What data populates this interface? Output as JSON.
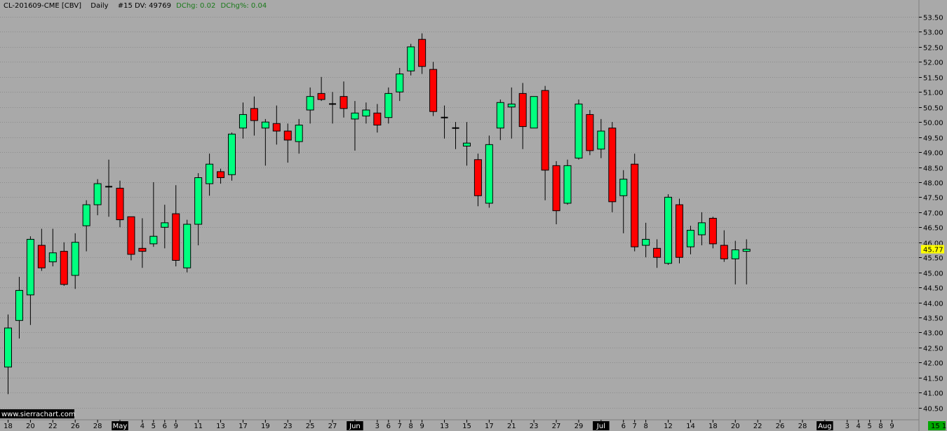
{
  "header": {
    "symbol": "CL-201609-CME [CBV]",
    "period": "Daily",
    "study": "#15 DV: 49769",
    "dchg": "DChg: 0.02",
    "dchg_pct": "DChg%: 0.04"
  },
  "watermark": "www.sierrachart.com",
  "last_price_label": "45.77",
  "corner_label": "15 1",
  "colors": {
    "background": "#a9a9a9",
    "up": "#00ff7f",
    "down": "#ff0000",
    "wick": "#000000",
    "gridline": "#8c8c8c",
    "last_price_bg": "#ffff00",
    "corner_bg": "#00a800",
    "header_green": "#1a7a1a"
  },
  "chart_data": {
    "type": "candlestick",
    "ylim": [
      40.3,
      53.8
    ],
    "grid": true,
    "y_ticks": [
      "40.50",
      "41.00",
      "41.50",
      "42.00",
      "42.50",
      "43.00",
      "43.50",
      "44.00",
      "44.50",
      "45.00",
      "45.50",
      "46.00",
      "46.50",
      "47.00",
      "47.50",
      "48.00",
      "48.50",
      "49.00",
      "49.50",
      "50.00",
      "50.50",
      "51.00",
      "51.50",
      "52.00",
      "52.50",
      "53.00",
      "53.50"
    ],
    "x_ticks": [
      {
        "label": "18",
        "i": 0
      },
      {
        "label": "20",
        "i": 2
      },
      {
        "label": "22",
        "i": 4
      },
      {
        "label": "26",
        "i": 6
      },
      {
        "label": "28",
        "i": 8
      },
      {
        "label": "May",
        "i": 10,
        "month": true
      },
      {
        "label": "4",
        "i": 12
      },
      {
        "label": "5",
        "i": 13
      },
      {
        "label": "6",
        "i": 14
      },
      {
        "label": "9",
        "i": 15
      },
      {
        "label": "11",
        "i": 17
      },
      {
        "label": "13",
        "i": 19
      },
      {
        "label": "17",
        "i": 21
      },
      {
        "label": "19",
        "i": 23
      },
      {
        "label": "23",
        "i": 25
      },
      {
        "label": "25",
        "i": 27
      },
      {
        "label": "27",
        "i": 29
      },
      {
        "label": "Jun",
        "i": 31,
        "month": true
      },
      {
        "label": "3",
        "i": 33
      },
      {
        "label": "6",
        "i": 34
      },
      {
        "label": "7",
        "i": 35
      },
      {
        "label": "8",
        "i": 36
      },
      {
        "label": "9",
        "i": 37
      },
      {
        "label": "13",
        "i": 39
      },
      {
        "label": "15",
        "i": 41
      },
      {
        "label": "17",
        "i": 43
      },
      {
        "label": "21",
        "i": 45
      },
      {
        "label": "23",
        "i": 47
      },
      {
        "label": "27",
        "i": 49
      },
      {
        "label": "29",
        "i": 51
      },
      {
        "label": "Jul",
        "i": 53,
        "month": true
      },
      {
        "label": "6",
        "i": 55
      },
      {
        "label": "7",
        "i": 56
      },
      {
        "label": "8",
        "i": 57
      },
      {
        "label": "12",
        "i": 59
      },
      {
        "label": "14",
        "i": 61
      },
      {
        "label": "18",
        "i": 63
      },
      {
        "label": "20",
        "i": 65
      },
      {
        "label": "22",
        "i": 67
      },
      {
        "label": "26",
        "i": 69
      },
      {
        "label": "28",
        "i": 71
      },
      {
        "label": "Aug",
        "i": 73,
        "month": true
      },
      {
        "label": "3",
        "i": 75
      },
      {
        "label": "4",
        "i": 76
      },
      {
        "label": "5",
        "i": 77
      },
      {
        "label": "8",
        "i": 78
      },
      {
        "label": "9",
        "i": 79
      }
    ],
    "candles": [
      {
        "o": 41.85,
        "h": 43.6,
        "l": 40.95,
        "c": 43.15
      },
      {
        "o": 43.4,
        "h": 44.85,
        "l": 42.8,
        "c": 44.4
      },
      {
        "o": 44.25,
        "h": 46.2,
        "l": 43.25,
        "c": 46.1
      },
      {
        "o": 45.9,
        "h": 46.45,
        "l": 45.05,
        "c": 45.15
      },
      {
        "o": 45.35,
        "h": 46.45,
        "l": 45.2,
        "c": 45.65
      },
      {
        "o": 45.7,
        "h": 46.0,
        "l": 44.55,
        "c": 44.6
      },
      {
        "o": 44.9,
        "h": 46.3,
        "l": 44.45,
        "c": 46.0
      },
      {
        "o": 46.55,
        "h": 47.4,
        "l": 45.7,
        "c": 47.25
      },
      {
        "o": 47.25,
        "h": 48.1,
        "l": 46.9,
        "c": 47.95
      },
      {
        "o": 47.85,
        "h": 48.75,
        "l": 46.85,
        "c": 47.85
      },
      {
        "o": 47.8,
        "h": 48.05,
        "l": 46.5,
        "c": 46.75
      },
      {
        "o": 46.85,
        "h": 46.85,
        "l": 45.4,
        "c": 45.6
      },
      {
        "o": 45.8,
        "h": 46.8,
        "l": 45.15,
        "c": 45.7
      },
      {
        "o": 45.95,
        "h": 48.0,
        "l": 45.85,
        "c": 46.2
      },
      {
        "o": 46.5,
        "h": 47.25,
        "l": 45.8,
        "c": 46.65
      },
      {
        "o": 46.95,
        "h": 47.9,
        "l": 45.2,
        "c": 45.4
      },
      {
        "o": 45.15,
        "h": 46.75,
        "l": 45.0,
        "c": 46.6
      },
      {
        "o": 46.6,
        "h": 48.3,
        "l": 45.9,
        "c": 48.15
      },
      {
        "o": 47.95,
        "h": 48.95,
        "l": 47.55,
        "c": 48.6
      },
      {
        "o": 48.35,
        "h": 48.45,
        "l": 47.95,
        "c": 48.15
      },
      {
        "o": 48.25,
        "h": 49.65,
        "l": 48.05,
        "c": 49.6
      },
      {
        "o": 49.8,
        "h": 50.65,
        "l": 49.45,
        "c": 50.25
      },
      {
        "o": 50.45,
        "h": 50.85,
        "l": 49.55,
        "c": 50.05
      },
      {
        "o": 49.8,
        "h": 50.1,
        "l": 48.55,
        "c": 50.0
      },
      {
        "o": 49.95,
        "h": 50.55,
        "l": 49.25,
        "c": 49.7
      },
      {
        "o": 49.7,
        "h": 49.95,
        "l": 48.65,
        "c": 49.4
      },
      {
        "o": 49.35,
        "h": 50.1,
        "l": 48.95,
        "c": 49.9
      },
      {
        "o": 50.4,
        "h": 51.15,
        "l": 49.95,
        "c": 50.85
      },
      {
        "o": 50.95,
        "h": 51.5,
        "l": 50.7,
        "c": 50.75
      },
      {
        "o": 50.6,
        "h": 51.0,
        "l": 49.95,
        "c": 50.6
      },
      {
        "o": 50.85,
        "h": 51.35,
        "l": 50.15,
        "c": 50.45
      },
      {
        "o": 50.1,
        "h": 50.7,
        "l": 49.05,
        "c": 50.3
      },
      {
        "o": 50.2,
        "h": 50.65,
        "l": 49.95,
        "c": 50.4
      },
      {
        "o": 50.3,
        "h": 50.6,
        "l": 49.65,
        "c": 49.9
      },
      {
        "o": 50.15,
        "h": 51.15,
        "l": 49.95,
        "c": 50.95
      },
      {
        "o": 51.0,
        "h": 51.8,
        "l": 50.7,
        "c": 51.6
      },
      {
        "o": 51.7,
        "h": 52.6,
        "l": 51.55,
        "c": 52.5
      },
      {
        "o": 52.75,
        "h": 52.95,
        "l": 51.6,
        "c": 51.85
      },
      {
        "o": 51.75,
        "h": 52.0,
        "l": 50.2,
        "c": 50.35
      },
      {
        "o": 50.15,
        "h": 50.55,
        "l": 49.45,
        "c": 50.15
      },
      {
        "o": 49.8,
        "h": 50.0,
        "l": 49.1,
        "c": 49.8
      },
      {
        "o": 49.2,
        "h": 50.0,
        "l": 48.55,
        "c": 49.3
      },
      {
        "o": 48.75,
        "h": 48.95,
        "l": 47.2,
        "c": 47.55
      },
      {
        "o": 47.3,
        "h": 49.55,
        "l": 47.15,
        "c": 49.25
      },
      {
        "o": 49.8,
        "h": 50.75,
        "l": 49.4,
        "c": 50.65
      },
      {
        "o": 50.5,
        "h": 51.15,
        "l": 49.45,
        "c": 50.6
      },
      {
        "o": 50.95,
        "h": 51.3,
        "l": 49.1,
        "c": 49.85
      },
      {
        "o": 49.8,
        "h": 50.85,
        "l": 49.8,
        "c": 50.85
      },
      {
        "o": 51.05,
        "h": 51.2,
        "l": 47.4,
        "c": 48.4
      },
      {
        "o": 48.55,
        "h": 48.7,
        "l": 46.6,
        "c": 47.05
      },
      {
        "o": 47.3,
        "h": 48.75,
        "l": 47.25,
        "c": 48.55
      },
      {
        "o": 48.8,
        "h": 50.75,
        "l": 48.75,
        "c": 50.6
      },
      {
        "o": 50.25,
        "h": 50.4,
        "l": 48.9,
        "c": 49.05
      },
      {
        "o": 49.1,
        "h": 50.1,
        "l": 48.8,
        "c": 49.7
      },
      {
        "o": 49.8,
        "h": 50.0,
        "l": 47.0,
        "c": 47.35
      },
      {
        "o": 47.55,
        "h": 48.4,
        "l": 46.3,
        "c": 48.1
      },
      {
        "o": 48.6,
        "h": 48.95,
        "l": 45.7,
        "c": 45.85
      },
      {
        "o": 45.9,
        "h": 46.65,
        "l": 45.5,
        "c": 46.1
      },
      {
        "o": 45.8,
        "h": 46.1,
        "l": 45.15,
        "c": 45.5
      },
      {
        "o": 45.3,
        "h": 47.6,
        "l": 45.25,
        "c": 47.5
      },
      {
        "o": 47.25,
        "h": 47.45,
        "l": 45.3,
        "c": 45.5
      },
      {
        "o": 45.85,
        "h": 46.55,
        "l": 45.6,
        "c": 46.4
      },
      {
        "o": 46.25,
        "h": 47.0,
        "l": 45.9,
        "c": 46.65
      },
      {
        "o": 46.8,
        "h": 46.85,
        "l": 45.8,
        "c": 45.95
      },
      {
        "o": 45.9,
        "h": 46.4,
        "l": 45.35,
        "c": 45.45
      },
      {
        "o": 45.45,
        "h": 46.05,
        "l": 44.6,
        "c": 45.75
      },
      {
        "o": 45.7,
        "h": 46.1,
        "l": 44.6,
        "c": 45.77
      }
    ]
  }
}
